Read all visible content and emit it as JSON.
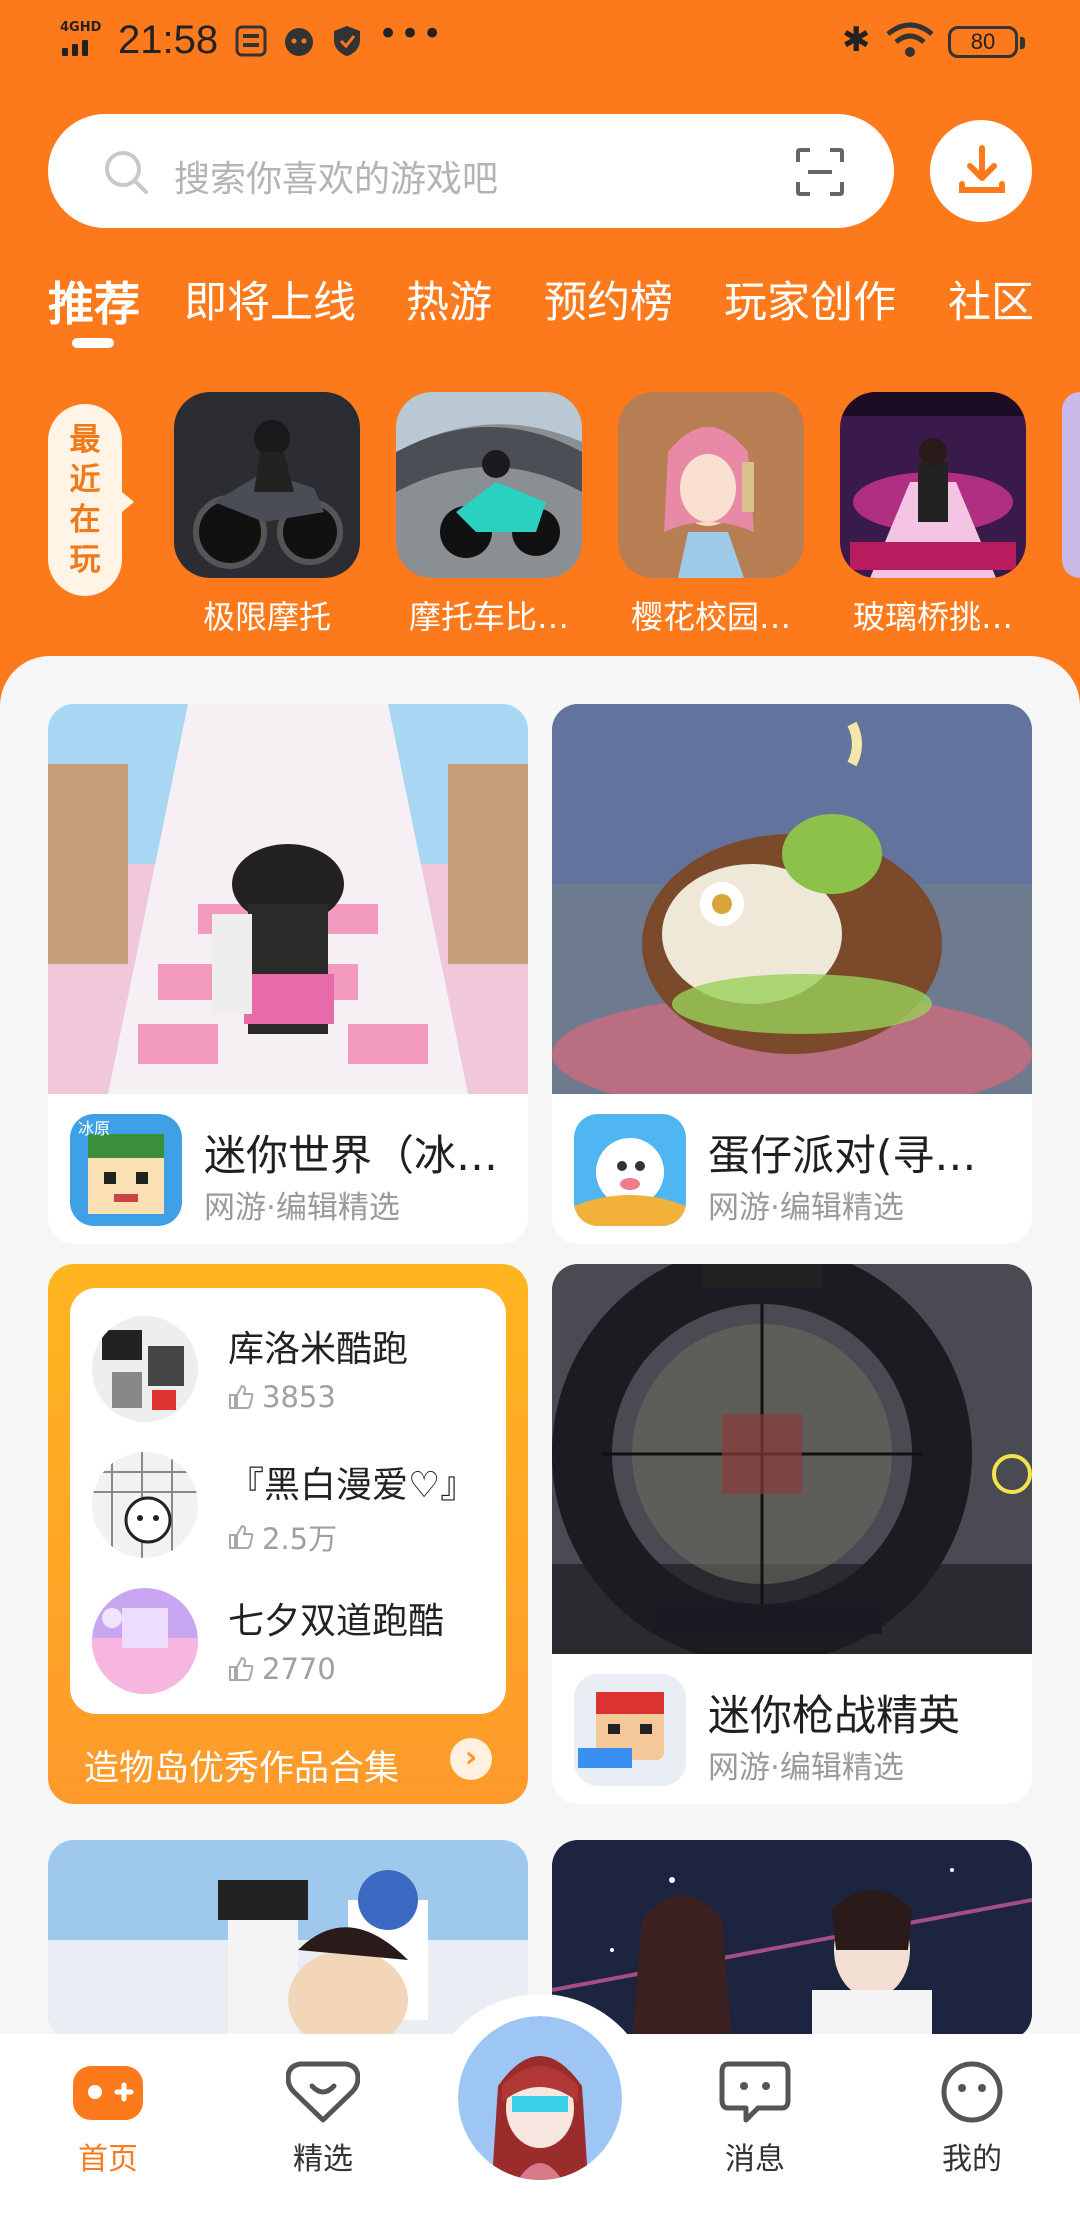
{
  "status_bar": {
    "network": "4GHD",
    "time": "21:58",
    "battery": "80"
  },
  "search": {
    "placeholder": "搜索你喜欢的游戏吧"
  },
  "tabs": [
    {
      "label": "推荐"
    },
    {
      "label": "即将上线"
    },
    {
      "label": "热游"
    },
    {
      "label": "预约榜"
    },
    {
      "label": "玩家创作"
    },
    {
      "label": "社区"
    }
  ],
  "recent": {
    "label": "最近在玩",
    "items": [
      {
        "name": "极限摩托"
      },
      {
        "name": "摩托车比…"
      },
      {
        "name": "樱花校园…"
      },
      {
        "name": "玻璃桥挑…"
      }
    ]
  },
  "game_cards": [
    {
      "title": "迷你世界（冰…",
      "subtitle": "网游·编辑精选"
    },
    {
      "title": "蛋仔派对(寻秘…",
      "subtitle": "网游·编辑精选"
    },
    {
      "title": "迷你枪战精英",
      "subtitle": "网游·编辑精选"
    }
  ],
  "collection": {
    "items": [
      {
        "title": "库洛米酷跑",
        "likes": "3853"
      },
      {
        "title": "『黑白漫爱♡』",
        "likes": "2.5万"
      },
      {
        "title": "七夕双道跑酷",
        "likes": "2770"
      }
    ],
    "footer": "造物岛优秀作品合集"
  },
  "bottom_nav": [
    {
      "label": "首页"
    },
    {
      "label": "精选"
    },
    {
      "label": "消息"
    },
    {
      "label": "我的"
    }
  ],
  "colors": {
    "brand": "#fd7a1c",
    "collection_gold": "#ffb51f"
  }
}
